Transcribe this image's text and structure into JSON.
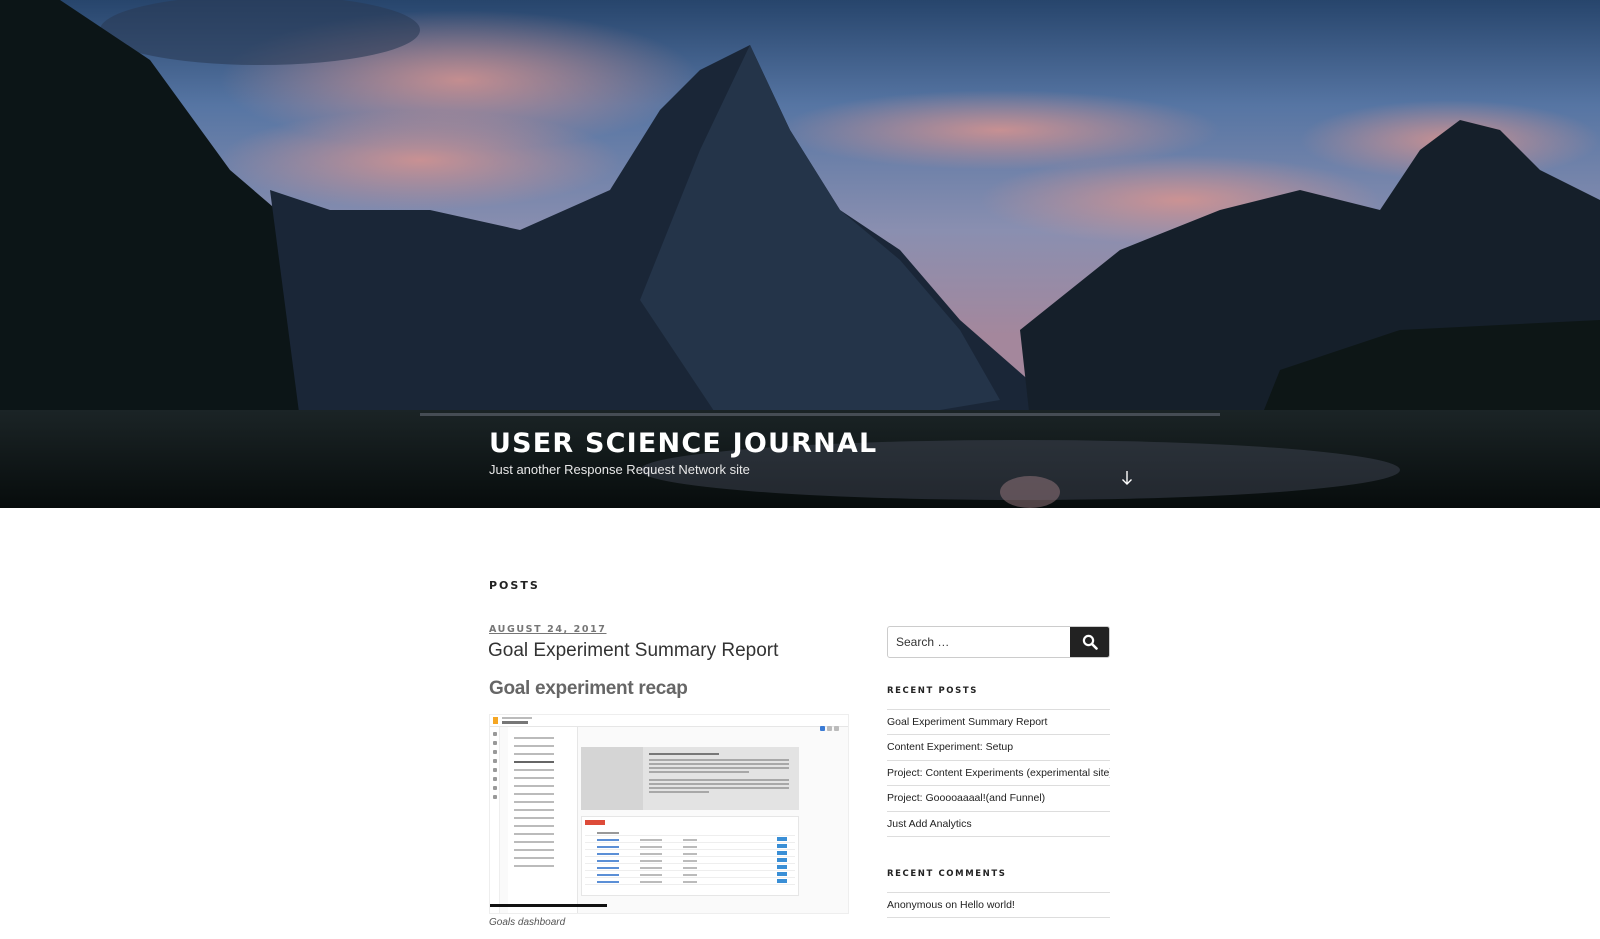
{
  "header": {
    "site_title": "USER SCIENCE JOURNAL",
    "site_description": "Just another Response Request Network site",
    "scroll_icon": "arrow-down-icon"
  },
  "main": {
    "page_label": "POSTS",
    "post": {
      "date": "AUGUST 24, 2017",
      "title": "Goal Experiment Summary Report",
      "subheading": "Goal experiment recap",
      "figure_caption": "Goals dashboard"
    }
  },
  "sidebar": {
    "search": {
      "placeholder": "Search …",
      "value": "",
      "button_icon": "search-icon"
    },
    "recent_posts": {
      "title": "RECENT POSTS",
      "items": [
        "Goal Experiment Summary Report",
        "Content Experiment: Setup",
        "Project: Content Experiments (experimental site)",
        "Project: Gooooaaaal!(and Funnel)",
        "Just Add Analytics"
      ]
    },
    "recent_comments": {
      "title": "RECENT COMMENTS",
      "items": [
        {
          "author": "Anonymous",
          "connector": "on",
          "post": "Hello world!"
        }
      ]
    }
  }
}
